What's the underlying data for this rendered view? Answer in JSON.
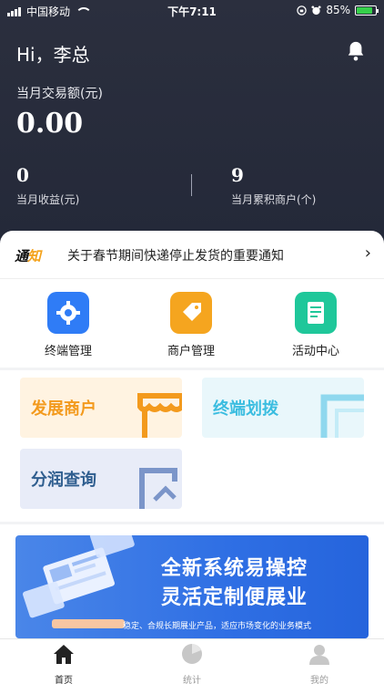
{
  "status_bar": {
    "carrier": "中国移动",
    "time": "下午7:11",
    "battery": "85%"
  },
  "header": {
    "greeting": "Hi，李总",
    "month_trade_label": "当月交易额(元)",
    "month_trade_value": "0.00",
    "stats": [
      {
        "value": "0",
        "label": "当月收益(元)"
      },
      {
        "value": "9",
        "label": "当月累积商户(个)"
      }
    ]
  },
  "notice": {
    "logo_text_a": "通",
    "logo_text_b": "知",
    "text": "关于春节期间快递停止发货的重要通知",
    "arrow": "›"
  },
  "quick_nav": [
    {
      "label": "终端管理",
      "icon": "gear-icon",
      "color": "#2f7cf6"
    },
    {
      "label": "商户管理",
      "icon": "tag-icon",
      "color": "#f5a51f"
    },
    {
      "label": "活动中心",
      "icon": "document-icon",
      "color": "#1fc79a"
    }
  ],
  "feature_cards": [
    {
      "label": "发展商户",
      "color": "#f39a1d"
    },
    {
      "label": "终端划拨",
      "color": "#3bbde0"
    },
    {
      "label": "分润查询",
      "color": "#2f5e8f"
    }
  ],
  "banner": {
    "title": "全新系统易操控",
    "subtitle": "灵活定制便展业",
    "tagline": "稳定、合规长期展业产品，适应市场变化的业务模式"
  },
  "tabbar": [
    {
      "label": "首页",
      "icon": "home-icon",
      "active": true
    },
    {
      "label": "统计",
      "icon": "pie-chart-icon",
      "active": false
    },
    {
      "label": "我的",
      "icon": "user-icon",
      "active": false
    }
  ]
}
